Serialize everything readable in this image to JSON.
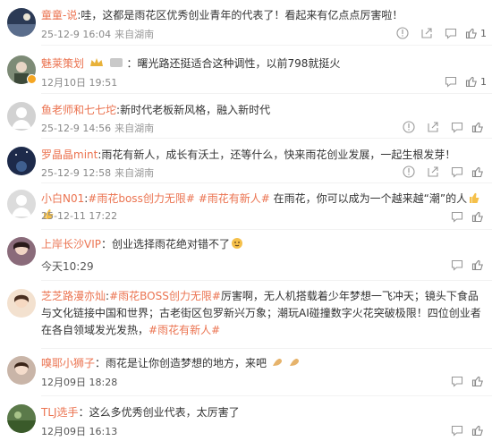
{
  "comments": [
    {
      "nickname": "童童-说",
      "text": "哇，这都是雨花区优秀创业青年的代表了！看起来有亿点点厉害啦！",
      "time": "25-12-9 16:04",
      "source": "来自湖南",
      "likes": "1",
      "avatar_color": "#2b3a55"
    },
    {
      "nickname": "魅莱策划",
      "text": "曙光路还挺适合这种调性，以前798就挺火",
      "time": "12月10日 19:51",
      "source": "",
      "likes": "1",
      "avatar_color": "#6f7f6a"
    },
    {
      "nickname": "鱼老师和七七坨",
      "text": "新时代老板新风格，融入新时代",
      "time": "25-12-9 14:56",
      "source": "来自湖南",
      "likes": "",
      "avatar_color": "#c9c9c9"
    },
    {
      "nickname": "罗晶晶mint",
      "text": "雨花有新人，成长有沃土，还等什么，快来雨花创业发展，一起生根发芽！",
      "time": "25-12-9 12:58",
      "source": "来自湖南",
      "likes": "",
      "avatar_color": "#1d2a4a"
    },
    {
      "nickname": "小白N01",
      "text_parts": [
        {
          "t": "#雨花boss创力无限#",
          "topic": true
        },
        {
          "t": " ",
          "topic": false
        },
        {
          "t": "#雨花有新人#",
          "topic": true
        },
        {
          "t": " 在雨花，你可以成为一个越来越“潮”的人",
          "topic": false
        }
      ],
      "time": "25-12-11 17:22",
      "source": "",
      "likes": "",
      "avatar_color": "#d6d6d6"
    },
    {
      "nickname": "上岸长沙VIP",
      "text": "创业选择雨花绝对错不了",
      "time": "今天10:29",
      "source": "",
      "likes": "",
      "avatar_color": "#8a6b7a"
    },
    {
      "nickname": "芝芝路漫亦灿",
      "text_parts": [
        {
          "t": "#雨花BOSS创力无限#",
          "topic": true
        },
        {
          "t": "厉害啊，无人机搭载着少年梦想一飞冲天；镜头下食品与文化链接中国和世界；古老街区包罗新兴万象；潮玩AI碰撞数字火花突破极限！四位创业者在各自领域发光发热，",
          "topic": false
        },
        {
          "t": "#雨花有新人#",
          "topic": true
        }
      ],
      "time": "",
      "source": "",
      "likes": "",
      "avatar_color": "#e8c9a8"
    },
    {
      "nickname": "嗅耶小狮子",
      "text": "雨花是让你创造梦想的地方，来吧",
      "time": "12月09日 18:28",
      "source": "",
      "likes": "",
      "avatar_color": "#9a7f75"
    },
    {
      "nickname": "TLJ选手",
      "text": "这么多优秀创业代表，太厉害了",
      "time": "12月09日 16:13",
      "source": "",
      "likes": "",
      "avatar_color": "#5b7a4a"
    }
  ],
  "colors": {
    "nickname": "#eb7350",
    "topic": "#eb7350",
    "meta": "#888888",
    "text": "#333333"
  },
  "icons": [
    "info-icon",
    "share-icon",
    "comment-icon",
    "like-icon"
  ]
}
